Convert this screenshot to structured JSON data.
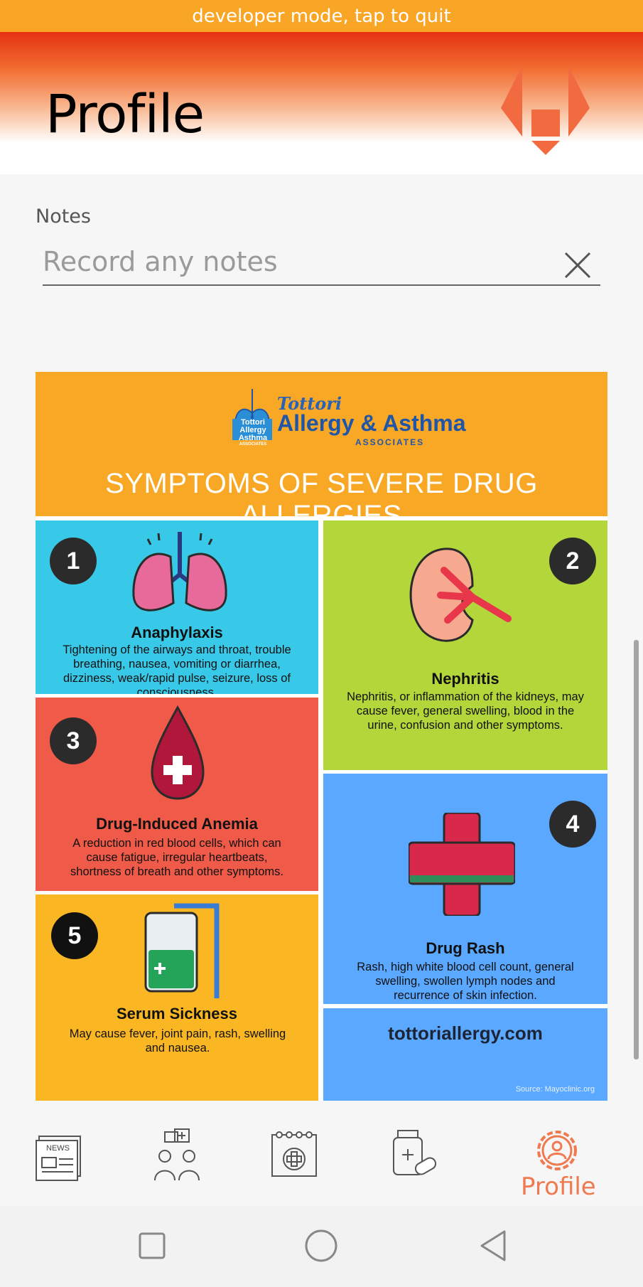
{
  "dev_banner": {
    "text": "developer mode, tap to quit"
  },
  "header": {
    "title": "Profile",
    "logo_icon": "app-logo-icon"
  },
  "notes": {
    "label": "Notes",
    "placeholder": "Record any notes",
    "value": ""
  },
  "infographic": {
    "brand_line1": "Tottori",
    "brand_line2": "Allergy & Asthma",
    "brand_line3": "ASSOCIATES",
    "logo_text": [
      "Tottori",
      "Allergy",
      "Asthma",
      "ASSOCIATES"
    ],
    "headline": "SYMPTOMS OF SEVERE DRUG ALLERGIES",
    "items": [
      {
        "number": "1",
        "title": "Anaphylaxis",
        "text": "Tightening of the airways and throat, trouble breathing, nausea, vomiting or diarrhea, dizziness, weak/rapid pulse, seizure, loss of consciousness.",
        "icon": "lungs-icon"
      },
      {
        "number": "2",
        "title": "Nephritis",
        "text": "Nephritis, or inflammation of the kidneys, may cause fever, general swelling, blood in the urine, confusion and other symptoms.",
        "icon": "kidney-icon"
      },
      {
        "number": "3",
        "title": "Drug-Induced Anemia",
        "text": "A reduction in red blood cells, which can cause fatigue, irregular heartbeats, shortness of breath and other symptoms.",
        "icon": "blood-drop-icon"
      },
      {
        "number": "4",
        "title": "Drug Rash",
        "text": "Rash, high white blood cell count, general swelling, swollen lymph nodes and recurrence of skin infection.",
        "icon": "medical-cross-icon"
      },
      {
        "number": "5",
        "title": "Serum Sickness",
        "text": "May cause fever, joint pain, rash, swelling and nausea.",
        "icon": "iv-bag-icon"
      }
    ],
    "website": "tottoriallergy.com",
    "source": "Source: Mayoclinic.org"
  },
  "bottom_nav": {
    "items": [
      {
        "icon": "news-icon",
        "label": "NEWS"
      },
      {
        "icon": "doctors-icon",
        "label": ""
      },
      {
        "icon": "calendar-icon",
        "label": ""
      },
      {
        "icon": "medication-icon",
        "label": ""
      },
      {
        "icon": "profile-gear-icon",
        "label": "Profile",
        "active": true
      }
    ],
    "active_color": "#f07a50"
  },
  "system_nav": {
    "icons": [
      "recents-icon",
      "home-icon",
      "back-icon"
    ]
  },
  "colors": {
    "banner": "#f9a526",
    "header_top": "#e53212",
    "accent": "#f07a50"
  }
}
